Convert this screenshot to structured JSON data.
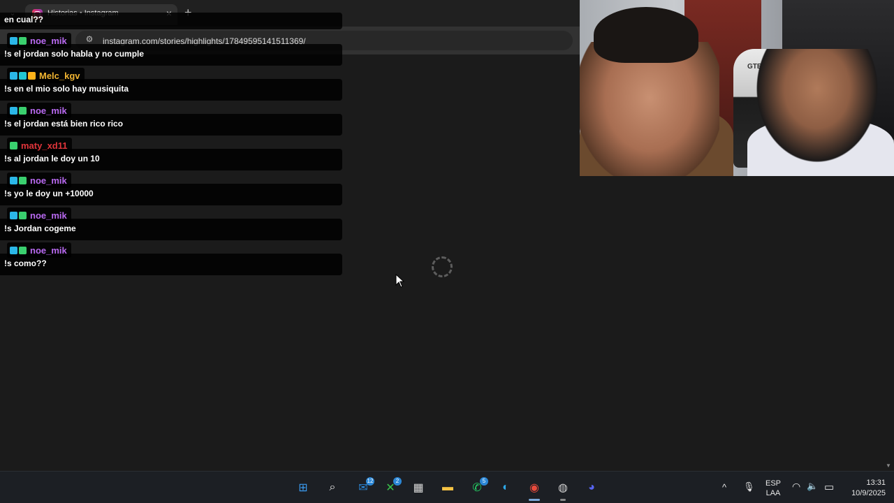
{
  "browser": {
    "tab_title": "Historias • Instagram",
    "url": "instagram.com/stories/highlights/17849595141511369/",
    "new_tab_symbol": "+",
    "close_symbol": "×",
    "tab_list_symbol": "⌄"
  },
  "chat": {
    "partial_message": "en cual??",
    "messages": [
      {
        "user": "noe_mik",
        "user_color": "#b869f0",
        "badges": [
          "blue",
          "green"
        ],
        "text": "!s el jordan solo habla y no cumple"
      },
      {
        "user": "Melc_kgv",
        "user_color": "#f0b431",
        "badges": [
          "blue",
          "cyan",
          "yellow"
        ],
        "text": "!s en el mio solo hay musiquita"
      },
      {
        "user": "noe_mik",
        "user_color": "#b869f0",
        "badges": [
          "blue",
          "green"
        ],
        "text": "!s el jordan está bien rico rico"
      },
      {
        "user": "maty_xd11",
        "user_color": "#e0343a",
        "badges": [
          "green"
        ],
        "text": "!s al jordan le doy un 10"
      },
      {
        "user": "noe_mik",
        "user_color": "#b869f0",
        "badges": [
          "blue",
          "green"
        ],
        "text": "!s yo le doy un +10000"
      },
      {
        "user": "noe_mik",
        "user_color": "#b869f0",
        "badges": [
          "blue",
          "green"
        ],
        "text": "!s Jordan cogeme"
      },
      {
        "user": "noe_mik",
        "user_color": "#b869f0",
        "badges": [
          "blue",
          "green"
        ],
        "text": "!s como??"
      }
    ]
  },
  "webcam": {
    "chair_text": "GTEK"
  },
  "taskbar": {
    "icons": [
      {
        "name": "windows-start-icon",
        "symbol": "⊞",
        "color": "#3a9bf0"
      },
      {
        "name": "search-icon",
        "symbol": "⌕",
        "color": "#e8e8e8"
      },
      {
        "name": "outlook-icon",
        "symbol": "✉",
        "color": "#2b87d6",
        "badge": "12"
      },
      {
        "name": "xbox-icon",
        "symbol": "✕",
        "color": "#3ac14b",
        "badge": "2"
      },
      {
        "name": "app-icon",
        "symbol": "▦",
        "color": "#d8d8d8"
      },
      {
        "name": "file-explorer-icon",
        "symbol": "▬",
        "color": "#f6c344"
      },
      {
        "name": "whatsapp-icon",
        "symbol": "✆",
        "color": "#25d366",
        "badge": "5"
      },
      {
        "name": "edge-icon",
        "symbol": "◐",
        "color": "#2ea8e8"
      },
      {
        "name": "chrome-icon",
        "symbol": "◉",
        "color": "#e84a3c"
      },
      {
        "name": "obs-icon",
        "symbol": "◍",
        "color": "#cfcfcf"
      },
      {
        "name": "discord-icon",
        "symbol": "◕",
        "color": "#5865f2"
      }
    ],
    "language_top": "ESP",
    "language_bottom": "LAA",
    "time": "13:31",
    "date": "10/9/2025",
    "tray_up_symbol": "^",
    "mic_symbol": "🎙",
    "wifi_symbol": "◠",
    "volume_symbol": "🔈",
    "battery_symbol": "▭"
  },
  "colors": {
    "page_bg": "#1b1b1b",
    "taskbar_bg": "#1c1f24"
  }
}
